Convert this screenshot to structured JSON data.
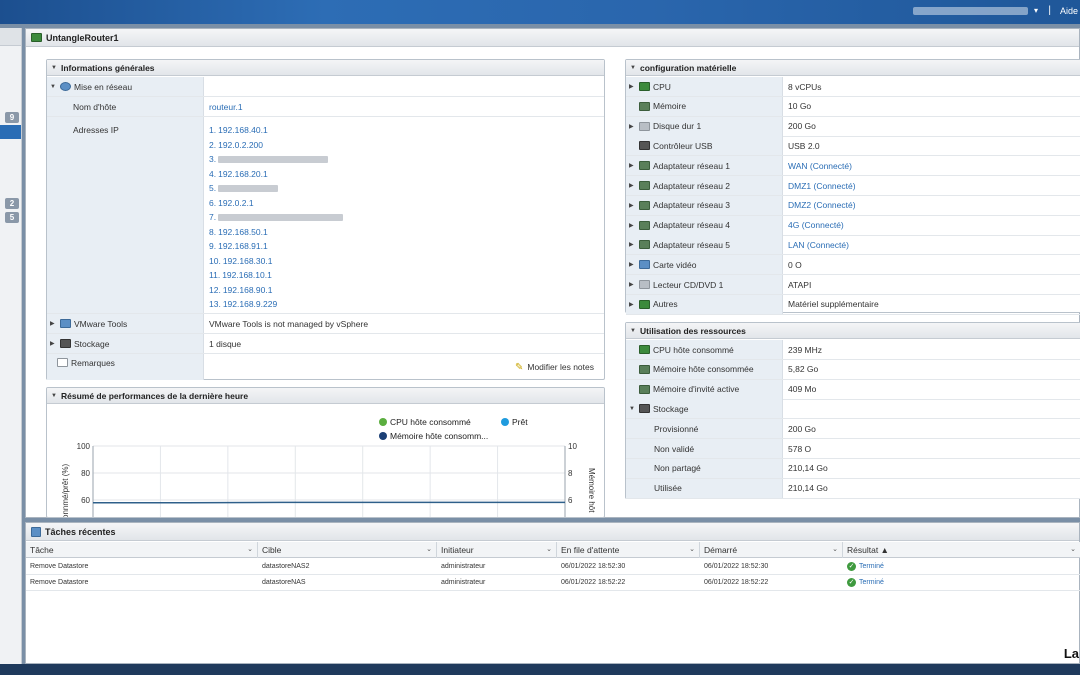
{
  "topbar": {
    "caret": "▾",
    "separator": "|",
    "help": "Aide"
  },
  "left": {
    "badges": [
      "9",
      "2",
      "5"
    ]
  },
  "window": {
    "title": "UntangleRouter1"
  },
  "general": {
    "header": "Informations générales",
    "network": {
      "label": "Mise en réseau"
    },
    "hostname": {
      "label": "Nom d'hôte",
      "value": "routeur.1"
    },
    "ips": {
      "label": "Adresses IP",
      "items": [
        {
          "prefix": "1.",
          "value": "192.168.40.1",
          "blurred": false
        },
        {
          "prefix": "2.",
          "value": "192.0.2.200",
          "blurred": false
        },
        {
          "prefix": "3.",
          "value": "",
          "blurred": true
        },
        {
          "prefix": "4.",
          "value": "192.168.20.1",
          "blurred": false
        },
        {
          "prefix": "5.",
          "value": "",
          "blurred": true
        },
        {
          "prefix": "6.",
          "value": "192.0.2.1",
          "blurred": false
        },
        {
          "prefix": "7.",
          "value": "",
          "blurred": true
        },
        {
          "prefix": "8.",
          "value": "192.168.50.1",
          "blurred": false
        },
        {
          "prefix": "9.",
          "value": "192.168.91.1",
          "blurred": false
        },
        {
          "prefix": "10.",
          "value": "192.168.30.1",
          "blurred": false
        },
        {
          "prefix": "11.",
          "value": "192.168.10.1",
          "blurred": false
        },
        {
          "prefix": "12.",
          "value": "192.168.90.1",
          "blurred": false
        },
        {
          "prefix": "13.",
          "value": "192.168.9.229",
          "blurred": false
        }
      ]
    },
    "vmware_tools": {
      "label": "VMware Tools",
      "value": "VMware Tools is not managed by vSphere"
    },
    "storage": {
      "label": "Stockage",
      "value": "1 disque"
    },
    "notes": {
      "label": "Remarques",
      "action": "Modifier les notes"
    }
  },
  "perf": {
    "header": "Résumé de performances de la dernière heure",
    "legend": {
      "cpu": "CPU hôte consommé",
      "ready": "Prêt",
      "mem": "Mémoire hôte consomm..."
    },
    "left_axis_title": "onnmé/prêt (%)",
    "right_axis_title": "Mémoire hôt",
    "colors": {
      "cpu": "#5bae3f",
      "ready": "#1f9bde",
      "mem": "#1b3f75",
      "line": "#2e5f8a"
    }
  },
  "chart_data": {
    "type": "line",
    "y_left_ticks": [
      "100",
      "80",
      "60"
    ],
    "y_right_ticks": [
      "10",
      "8",
      "6"
    ],
    "series": [
      {
        "name": "Mémoire hôte consomm...",
        "values": [
          5.8,
          5.8,
          5.82,
          5.82,
          5.82,
          5.82
        ]
      }
    ]
  },
  "hardware": {
    "header": "configuration matérielle",
    "rows": [
      {
        "label": "CPU",
        "value": "8 vCPUs",
        "link": false,
        "expand": true,
        "icon": "cpu-icon"
      },
      {
        "label": "Mémoire",
        "value": "10 Go",
        "link": false,
        "expand": false,
        "icon": "memory-icon"
      },
      {
        "label": "Disque dur 1",
        "value": "200 Go",
        "link": false,
        "expand": true,
        "icon": "disk-icon"
      },
      {
        "label": "Contrôleur USB",
        "value": "USB 2.0",
        "link": false,
        "expand": false,
        "icon": "usb-icon"
      },
      {
        "label": "Adaptateur réseau 1",
        "value": "WAN (Connecté)",
        "link": true,
        "expand": true,
        "icon": "network-adapter-icon"
      },
      {
        "label": "Adaptateur réseau 2",
        "value": "DMZ1 (Connecté)",
        "link": true,
        "expand": true,
        "icon": "network-adapter-icon"
      },
      {
        "label": "Adaptateur réseau 3",
        "value": "DMZ2 (Connecté)",
        "link": true,
        "expand": true,
        "icon": "network-adapter-icon"
      },
      {
        "label": "Adaptateur réseau 4",
        "value": "4G (Connecté)",
        "link": true,
        "expand": true,
        "icon": "network-adapter-icon"
      },
      {
        "label": "Adaptateur réseau 5",
        "value": "LAN (Connecté)",
        "link": true,
        "expand": true,
        "icon": "network-adapter-icon"
      },
      {
        "label": "Carte vidéo",
        "value": "0 O",
        "link": false,
        "expand": true,
        "icon": "video-card-icon"
      },
      {
        "label": "Lecteur CD/DVD 1",
        "value": "ATAPI",
        "link": false,
        "expand": true,
        "icon": "cd-dvd-icon"
      },
      {
        "label": "Autres",
        "value": "Matériel supplémentaire",
        "link": false,
        "expand": true,
        "icon": "other-hardware-icon"
      }
    ]
  },
  "resources": {
    "header": "Utilisation des ressources",
    "rows": [
      {
        "label": "CPU hôte consommé",
        "value": "239 MHz",
        "indent": 1,
        "icon": "cpu-icon"
      },
      {
        "label": "Mémoire hôte consommée",
        "value": "5,82 Go",
        "indent": 1,
        "icon": "memory-icon"
      },
      {
        "label": "Mémoire d'invité active",
        "value": "409 Mo",
        "indent": 1,
        "icon": "memory-icon"
      },
      {
        "label": "Stockage",
        "value": "",
        "indent": 0,
        "icon": "storage-icon",
        "expanded": true
      },
      {
        "label": "Provisionné",
        "value": "200 Go",
        "indent": 2,
        "icon": ""
      },
      {
        "label": "Non validé",
        "value": "578 O",
        "indent": 2,
        "icon": ""
      },
      {
        "label": "Non partagé",
        "value": "210,14 Go",
        "indent": 2,
        "icon": ""
      },
      {
        "label": "Utilisée",
        "value": "210,14 Go",
        "indent": 2,
        "icon": ""
      }
    ]
  },
  "tasks": {
    "title": "Tâches récentes",
    "columns": [
      "Tâche",
      "Cible",
      "Initiateur",
      "En file d'attente",
      "Démarré",
      "Résultat ▲"
    ],
    "rows": [
      {
        "task": "Remove Datastore",
        "target": "datastoreNAS2",
        "initiator": "administrateur",
        "queued": "06/01/2022 18:52:30",
        "started": "06/01/2022 18:52:30",
        "result": "Terminé"
      },
      {
        "task": "Remove Datastore",
        "target": "datastoreNAS",
        "initiator": "administrateur",
        "queued": "06/01/2022 18:52:22",
        "started": "06/01/2022 18:52:22",
        "result": "Terminé"
      }
    ],
    "corner_text": "La"
  }
}
